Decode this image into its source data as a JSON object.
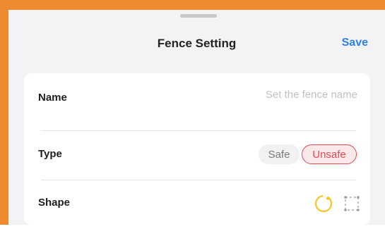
{
  "header": {
    "title": "Fence Setting",
    "save_label": "Save"
  },
  "form": {
    "name": {
      "label": "Name",
      "placeholder": "Set the fence name",
      "value": ""
    },
    "type": {
      "label": "Type",
      "options": [
        {
          "label": "Safe",
          "selected": false
        },
        {
          "label": "Unsafe",
          "selected": true
        }
      ]
    },
    "shape": {
      "label": "Shape",
      "options": [
        {
          "icon": "circle-shape-icon",
          "selected": true
        },
        {
          "icon": "rectangle-shape-icon",
          "selected": false
        }
      ]
    }
  },
  "colors": {
    "accent": "#2d82e8",
    "unsafe": "#e04b52",
    "circle_selected": "#f5c526",
    "frame": "#ee8a2f"
  }
}
